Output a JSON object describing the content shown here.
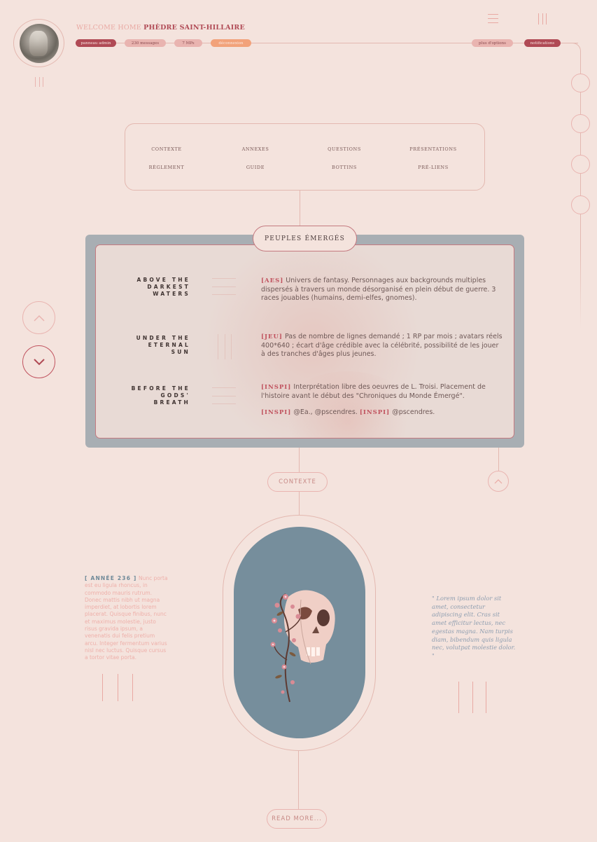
{
  "header": {
    "welcome_prefix": "WELCOME HOME",
    "user_name": "PHÈDRE SAINT-HILLAIRE",
    "pills": {
      "admin": "panneau admin",
      "messages": "230 messages",
      "mps": "7 MPs",
      "logout": "déconnexion",
      "options": "plus d'options",
      "notifications": "notifications"
    },
    "icons": {
      "avatar": "avatar-image",
      "menu": "hamburger-icon",
      "columns": "columns-icon"
    }
  },
  "nav": {
    "items": [
      "CONTEXTE",
      "ANNEXES",
      "QUESTIONS",
      "PRÉSENTATIONS",
      "RÈGLEMENT",
      "GUIDE",
      "BOTTINS",
      "PRÉ-LIENS"
    ]
  },
  "card": {
    "title": "PEUPLES ÉMERGÉS",
    "rows": [
      {
        "title": "ABOVE THE\nDARKEST\nWATERS",
        "tag": "[AES]",
        "text": "Univers de fantasy. Personnages aux backgrounds multiples dispersés à travers un monde désorganisé en plein début de guerre. 3 races jouables (humains, demi-elfes, gnomes)."
      },
      {
        "title": "UNDER THE\nETERNAL\nSUN",
        "tag": "[JEU]",
        "text": "Pas de nombre de lignes demandé ; 1 RP par mois ; avatars réels 400*640 ; écart d'âge crédible avec la célébrité, possibilité de les jouer à des tranches d'âges plus jeunes."
      },
      {
        "title": "BEFORE THE\nGODS'\nBREATH",
        "tag": "[INSPI]",
        "text": "Interprétation libre des oeuvres de L. Troisi. Placement de l'histoire avant le début des \"Chroniques du Monde Émergé\".",
        "credit_tag_1": "[INSPI]",
        "credit_1": "@Ea., @pscendres.",
        "credit_tag_2": "[INSPI]",
        "credit_2": "@pscendres."
      }
    ]
  },
  "buttons": {
    "contexte": "CONTEXTE",
    "read_more": "READ MORE..."
  },
  "lower": {
    "year_label": "[ ANNÉE 236 ]",
    "side_text": "Nunc porta est eu ligula rhoncus, in commodo mauris rutrum. Donec mattis nibh ut magna imperdiet, at lobortis lorem placerat. Quisque finibus, nunc et maximus molestie, justo risus gravida ipsum, a venenatis dui felis pretium arcu. Integer fermentum varius nisl nec luctus. Quisque cursus a tortor vitae porta.",
    "quote": "\" Lorem ipsum dolor sit amet, consectetur adipiscing elit. Cras sit amet efficitur lectus, nec egestas magna. Nam turpis diam, bibendum quis ligula nec, volutpat molestie dolor. \"",
    "image": "skull-with-flowers-illustration"
  },
  "colors": {
    "background": "#f4e3dd",
    "accent": "#b04a55",
    "pill_light": "#e9b4b0",
    "orange": "#f2a27a",
    "slate": "#768e9c",
    "card_frame": "#a8aeb3"
  }
}
